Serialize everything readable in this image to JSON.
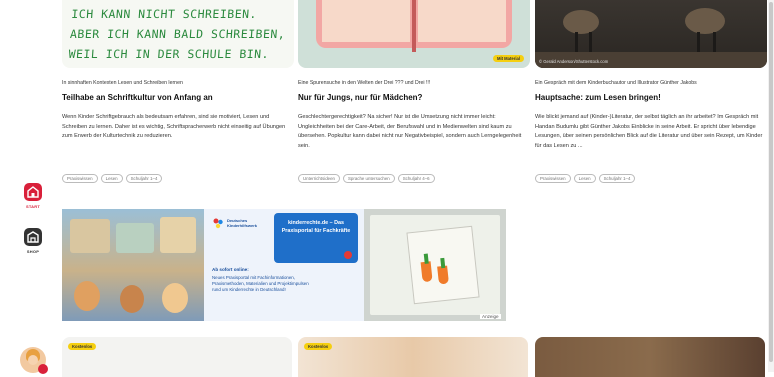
{
  "sidebar": {
    "items": [
      {
        "label": "START",
        "icon": "home-icon",
        "color": "#d9203a"
      },
      {
        "label": "SHOP",
        "icon": "shop-icon",
        "color": "#333333"
      }
    ]
  },
  "cards": [
    {
      "image_text": [
        "ICH KANN NICHT SCHREIBEN.",
        "ABER ICH KANN BALD SCHREIBEN,",
        "WEIL ICH IN DER SCHULE BIN."
      ],
      "kicker": "In sinnhaften Kontexten Lesen und Schreiben lernen",
      "title": "Teilhabe an Schriftkultur von Anfang an",
      "description": "Wenn Kinder Schriftgebrauch als bedeutsam erfahren, sind sie motiviert, Lesen und Schreiben zu lernen. Daher ist es wichtig, Schriftspracherwerb nicht einseitig auf Übungen zum Erwerb der Kulturtechnik zu reduzieren.",
      "tags": [
        "Praxiswissen",
        "Lesen",
        "Schuljahr 1–4"
      ]
    },
    {
      "badge": "Mit Material",
      "kicker": "Eine Spurensuche in den Welten der Drei ??? und Drei !!!",
      "title": "Nur für Jungs, nur für Mädchen?",
      "description": "Geschlechtergerechtigkeit? Na sicher! Nur ist die Umsetzung nicht immer leicht: Ungleichheiten bei der Care-Arbeit, der Berufswahl und in Medienwelten sind kaum zu übersehen. Popkultur kann dabei nicht nur Negativbeispiel, sondern auch Lerngelegenheit sein.",
      "tags": [
        "Unterrichtsideen",
        "Sprache untersuchen",
        "Schuljahr 4–6"
      ]
    },
    {
      "credit": "© Gerald Anderson/Shutterstock.com",
      "kicker": "Ein Gespräch mit dem Kinderbuchautor und Illustrator Günther Jakobs",
      "title": "Hauptsache: zum Lesen bringen!",
      "description": "Wie blickt jemand auf (Kinder-)Literatur, der selbst täglich an ihr arbeitet? Im Gespräch mit Handan Budumlu gibt Günther Jakobs Einblicke in seine Arbeit. Er spricht über lebendige Lesungen, über seinen persönlichen Blick auf die Literatur und über sein Rezept, um Kinder für das Lesen zu ...",
      "tags": [
        "Praxiswissen",
        "Lesen",
        "Schuljahr 1–4"
      ]
    }
  ],
  "banner": {
    "org": "Deutsches Kinderhilfswerk",
    "headline": "kinderrechte.de – Das Praxisportal für Fachkräfte",
    "promo_title": "Ab sofort online:",
    "promo_text": "Neues Praxisportal mit Fachinformationen, Praxismethoden, Materialien und Projektimpulsen rund um Kinderrechte in Deutschland!",
    "ad_label": "Anzeige"
  },
  "bottom_cards": [
    {
      "badge": "Kostenlos"
    },
    {
      "badge": "Kostenlos"
    },
    {}
  ]
}
